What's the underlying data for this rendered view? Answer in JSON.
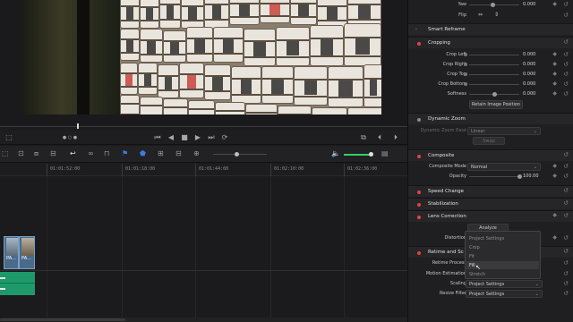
{
  "viewer": {
    "timecode_dots": "● ○ ●"
  },
  "transport": {
    "buttons": [
      "⏮",
      "◀",
      "■",
      "▶",
      "⏭",
      "⟳"
    ]
  },
  "ruler": {
    "timecodes": [
      "01:01:52:00",
      "01:01:18:00",
      "01:01:44:00",
      "01:02:10:00",
      "01:02:36:00"
    ]
  },
  "clips": [
    {
      "label": "PA..."
    },
    {
      "label": "PA..."
    }
  ],
  "inspector": {
    "top_rows": [
      {
        "label": "Yaw",
        "value": "0.000"
      },
      {
        "label": "Flip",
        "value": ""
      }
    ],
    "smart_reframe": "Smart Reframe",
    "cropping": {
      "title": "Cropping",
      "rows": [
        {
          "label": "Crop Left",
          "value": "0.000"
        },
        {
          "label": "Crop Right",
          "value": "0.000"
        },
        {
          "label": "Crop Top",
          "value": "0.000"
        },
        {
          "label": "Crop Bottom",
          "value": "0.000"
        },
        {
          "label": "Softness",
          "value": "0.000"
        }
      ],
      "retain_button": "Retain Image Position"
    },
    "dynamic_zoom": {
      "title": "Dynamic Zoom",
      "ease_label": "Dynamic Zoom Ease",
      "ease_value": "Linear",
      "swap_button": "Swap"
    },
    "composite": {
      "title": "Composite",
      "mode_label": "Composite Mode",
      "mode_value": "Normal",
      "opacity_label": "Opacity",
      "opacity_value": "100.00"
    },
    "speed_change": "Speed Change",
    "stabilization": "Stabilization",
    "lens_correction": {
      "title": "Lens Correction",
      "analyze_button": "Analyze",
      "distortion_label": "Distortion"
    },
    "retime": {
      "title": "Retime and Scaling",
      "process_label": "Retime Process",
      "motion_label": "Motion Estimation",
      "scaling_label": "Scaling",
      "scaling_value": "Project Settings",
      "resize_label": "Resize Filter",
      "resize_value": "Project Settings"
    },
    "scaling_menu": {
      "options": [
        "Project Settings",
        "Crop",
        "Fit",
        "Fill",
        "Stretch"
      ],
      "selected": "Fill"
    }
  },
  "colors": {
    "accent_red": "#e2453c",
    "clip_green": "#1e9a6a",
    "audio_green": "#2fd06a"
  }
}
